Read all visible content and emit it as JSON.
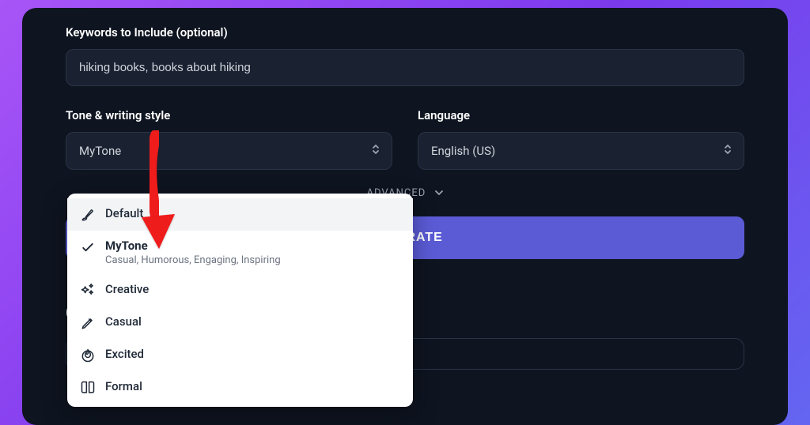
{
  "keywords": {
    "label": "Keywords to Include (optional)",
    "value": "hiking books, books about hiking"
  },
  "tone": {
    "label": "Tone & writing style",
    "selected": "MyTone",
    "options": [
      {
        "label": "Default"
      },
      {
        "label": "MyTone",
        "sub": "Casual, Humorous, Engaging, Inspiring"
      },
      {
        "label": "Creative"
      },
      {
        "label": "Casual"
      },
      {
        "label": "Excited"
      },
      {
        "label": "Formal"
      }
    ]
  },
  "language": {
    "label": "Language",
    "selected": "English (US)"
  },
  "advanced_label": "ADVANCED",
  "generate_label": "GENERATE",
  "creations_label": "Creations"
}
